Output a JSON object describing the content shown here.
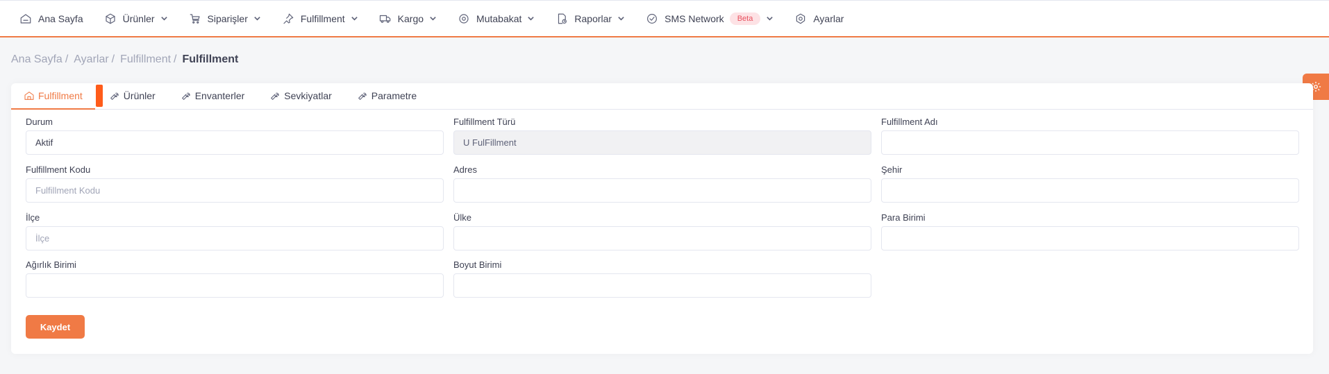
{
  "nav": {
    "items": [
      {
        "label": "Ana Sayfa",
        "icon": "home-icon"
      },
      {
        "label": "Ürünler",
        "icon": "box-icon"
      },
      {
        "label": "Siparişler",
        "icon": "cart-icon"
      },
      {
        "label": "Fulfillment",
        "icon": "pin-icon"
      },
      {
        "label": "Kargo",
        "icon": "truck-icon"
      },
      {
        "label": "Mutabakat",
        "icon": "target-icon"
      },
      {
        "label": "Raporlar",
        "icon": "report-icon"
      },
      {
        "label": "SMS Network",
        "icon": "check-circle-icon",
        "badge": "Beta"
      },
      {
        "label": "Ayarlar",
        "icon": "settings-icon"
      }
    ]
  },
  "breadcrumb": {
    "items": [
      "Ana Sayfa",
      "Ayarlar",
      "Fulfillment"
    ],
    "current": "Fulfillment"
  },
  "tabs": [
    {
      "label": "Fulfillment",
      "icon": "home-icon",
      "active": true
    },
    {
      "label": "Ürünler",
      "icon": "wrench-icon"
    },
    {
      "label": "Envanterler",
      "icon": "wrench-icon"
    },
    {
      "label": "Sevkiyatlar",
      "icon": "wrench-icon"
    },
    {
      "label": "Parametre",
      "icon": "wrench-icon"
    }
  ],
  "form": {
    "durum": {
      "label": "Durum",
      "value": "Aktif",
      "placeholder": ""
    },
    "turu": {
      "label": "Fulfillment Türü",
      "value": "U FulFillment",
      "placeholder": ""
    },
    "adi": {
      "label": "Fulfillment Adı",
      "value": "",
      "placeholder": ""
    },
    "kodu": {
      "label": "Fulfillment Kodu",
      "value": "",
      "placeholder": "Fulfillment Kodu"
    },
    "adres": {
      "label": "Adres",
      "value": "",
      "placeholder": ""
    },
    "sehir": {
      "label": "Şehir",
      "value": "",
      "placeholder": ""
    },
    "ilce": {
      "label": "İlçe",
      "value": "",
      "placeholder": "İlçe"
    },
    "ulke": {
      "label": "Ülke",
      "value": "",
      "placeholder": ""
    },
    "para": {
      "label": "Para Birimi",
      "value": "",
      "placeholder": ""
    },
    "agirlik": {
      "label": "Ağırlık Birimi",
      "value": "",
      "placeholder": ""
    },
    "boyut": {
      "label": "Boyut Birimi",
      "value": "",
      "placeholder": ""
    },
    "save_label": "Kaydet"
  },
  "colors": {
    "accent": "#f07a45",
    "badge_bg": "#fde2e5",
    "badge_text": "#e8515e"
  }
}
